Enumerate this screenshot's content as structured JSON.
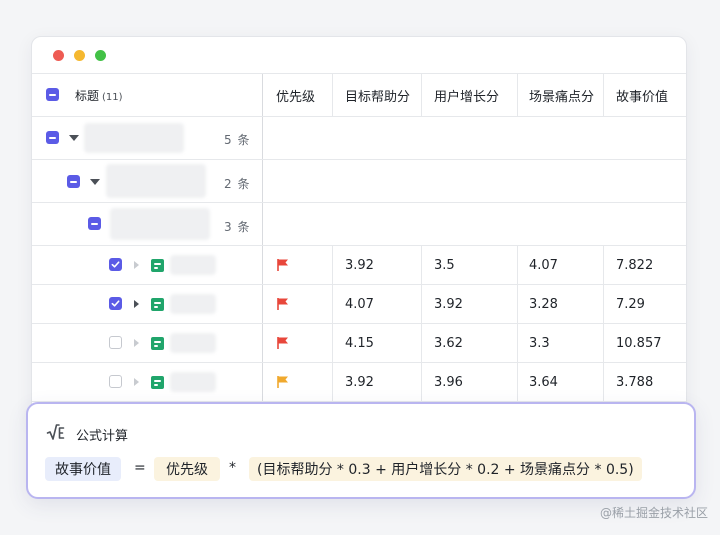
{
  "table": {
    "header": {
      "title": "标题",
      "title_count": "(11)",
      "columns": [
        "优先级",
        "目标帮助分",
        "用户增长分",
        "场景痛点分",
        "故事价值"
      ]
    },
    "groups": [
      {
        "count": "5 条"
      },
      {
        "count": "2 条"
      },
      {
        "count": "3 条"
      }
    ],
    "rows": [
      {
        "checked": true,
        "priority": "high",
        "v1": "3.92",
        "v2": "3.5",
        "v3": "4.07",
        "v4": "7.822"
      },
      {
        "checked": true,
        "priority": "high",
        "v1": "4.07",
        "v2": "3.92",
        "v3": "3.28",
        "v4": "7.29"
      },
      {
        "checked": false,
        "priority": "high",
        "v1": "4.15",
        "v2": "3.62",
        "v3": "3.3",
        "v4": "10.857"
      },
      {
        "checked": false,
        "priority": "medium",
        "v1": "3.92",
        "v2": "3.96",
        "v3": "3.64",
        "v4": "3.788"
      }
    ]
  },
  "formula": {
    "label": "公式计算",
    "result_field": "故事价值",
    "equals": "=",
    "factor_field": "优先级",
    "times": "*",
    "expression": "(目标帮助分 * 0.3 + 用户增长分 * 0.2 + 场景痛点分 * 0.5)"
  },
  "watermark": "@稀土掘金技术社区",
  "colors": {
    "accent": "#5b5be6",
    "flag_high": "#e8473b",
    "flag_medium": "#f0a92e",
    "doc_icon": "#20a56b",
    "formula_border": "#b9b5f0"
  },
  "icons": [
    "minus-checkbox-icon",
    "checkbox-icon",
    "caret-down-icon",
    "caret-right-icon",
    "doc-icon",
    "flag-icon",
    "sqrt-formula-icon"
  ]
}
